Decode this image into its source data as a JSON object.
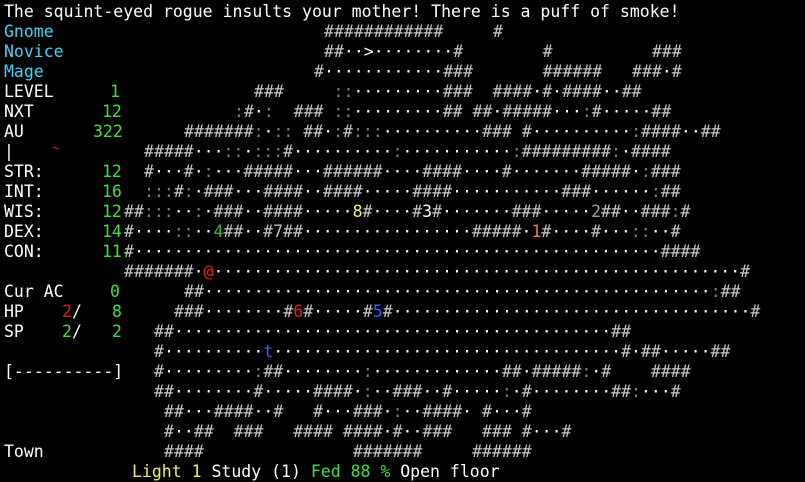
{
  "message": "The squint-eyed rogue insults your mother! There is a puff of smoke!",
  "character": {
    "race": "Gnome",
    "title": "Novice",
    "class": "Mage"
  },
  "stats": {
    "level_label": "LEVEL",
    "level": "1",
    "nxt_label": "NXT",
    "nxt": "12",
    "au_label": "AU",
    "au": "322",
    "equip_label": "|",
    "equip_mark": "~",
    "str_label": "STR:",
    "str": "12",
    "int_label": "INT:",
    "int": "16",
    "wis_label": "WIS:",
    "wis": "12",
    "dex_label": "DEX:",
    "dex": "14",
    "con_label": "CON:",
    "con": "11",
    "ac_label": "Cur AC",
    "ac": "0",
    "hp_label": "HP",
    "hp_cur": "2",
    "hp_sep": "/",
    "hp_max": "8",
    "sp_label": "SP",
    "sp_cur": "2",
    "sp_sep": "/",
    "sp_max": "2",
    "health_bar": "[----------]",
    "location": "Town"
  },
  "status_bar": {
    "light": "Light 1",
    "study": "Study (1)",
    "fed": "Fed 88 %",
    "terrain": "Open floor"
  },
  "map_rows": [
    {
      "row": 1,
      "col": 32,
      "text": "############     #"
    },
    {
      "row": 2,
      "col": 32,
      "text": "##··>········#        #          ###"
    },
    {
      "row": 3,
      "col": 31,
      "text": "#············###       ######   ###·#"
    },
    {
      "row": 4,
      "col": 25,
      "text": "###     ::·········###  ####·#·####··##"
    },
    {
      "row": 5,
      "col": 23,
      "text": ":#·:  ### ::·········## ##·#####···:#·····##"
    },
    {
      "row": 6,
      "col": 18,
      "text": "#######:·:: ##·:#:::··········### #··········:####··##"
    },
    {
      "row": 7,
      "col": 14,
      "text": "#####···::·:::#··········:···········:#########:·####"
    },
    {
      "row": 8,
      "col": 14,
      "text": "#···#·:···#####···######····####····#·······#####·:###"
    },
    {
      "row": 9,
      "col": 14,
      "text": ":::#:·###···####··####·····####···········###······:##"
    },
    {
      "row": 10,
      "col": 12,
      "text": "##:::··:·###··####·····8#····#3#·······###·····2##··###:#"
    },
    {
      "row": 11,
      "col": 12,
      "text": "#····::··4##··#7##·················#####·1#····#···::··#"
    },
    {
      "row": 12,
      "col": 12,
      "text": "#·····················································####"
    },
    {
      "row": 13,
      "col": 12,
      "text": "#######·@·····················································#"
    },
    {
      "row": 14,
      "col": 18,
      "text": "##···················································:##"
    },
    {
      "row": 15,
      "col": 17,
      "text": "###········#6#·····#5#····································#"
    },
    {
      "row": 16,
      "col": 15,
      "text": "##············································##"
    },
    {
      "row": 17,
      "col": 15,
      "text": "#··········t···································#·##·····##"
    },
    {
      "row": 18,
      "col": 15,
      "text": "#·········:##········:·············##·#####:·#    ####"
    },
    {
      "row": 19,
      "col": 15,
      "text": "##········#·····####·:··###··#·····:·#········##:···#"
    },
    {
      "row": 20,
      "col": 16,
      "text": "##···####··#   #···###·:··####· #···#"
    },
    {
      "row": 21,
      "col": 16,
      "text": "#··##  ###   #### ####·#··###   ### #···#"
    },
    {
      "row": 22,
      "col": 16,
      "text": "####               #######     ######"
    }
  ]
}
